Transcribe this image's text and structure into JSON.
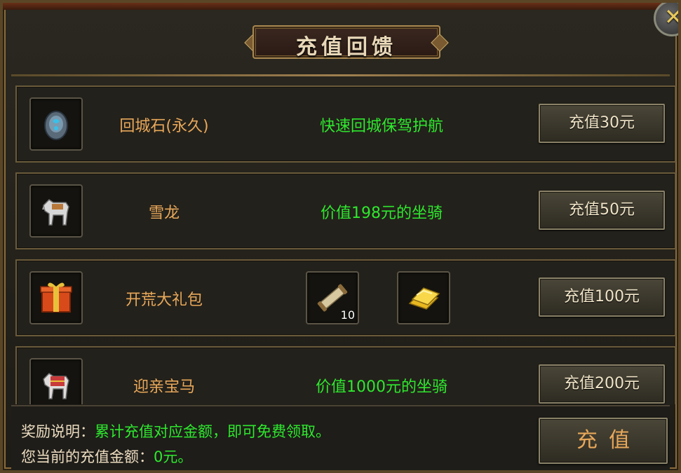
{
  "window": {
    "title": "充值回馈",
    "close_icon": "close-icon"
  },
  "rewards": [
    {
      "icon": "recall-stone-icon",
      "name": "回城石(永久)",
      "description": "快速回城保驾护航",
      "button": "充值30元"
    },
    {
      "icon": "white-horse-icon",
      "name": "雪龙",
      "description": "价值198元的坐骑",
      "button": "充值50元"
    },
    {
      "icon": "gift-box-icon",
      "name": "开荒大礼包",
      "description": "",
      "extra_items": [
        {
          "icon": "scroll-icon",
          "count": "10"
        },
        {
          "icon": "gold-bar-icon",
          "count": ""
        }
      ],
      "button": "充值100元"
    },
    {
      "icon": "armored-horse-icon",
      "name": "迎亲宝马",
      "description": "价值1000元的坐骑",
      "button": "充值200元"
    }
  ],
  "footer": {
    "reward_label": "奖励说明：",
    "reward_text": "累计充值对应金额，即可免费领取。",
    "amount_label": "您当前的充值金额：",
    "amount_value": "0元。",
    "recharge_button": "充值"
  },
  "colors": {
    "name": "#e8a85a",
    "description": "#2ee82e",
    "frame": "#6a5a3a"
  }
}
